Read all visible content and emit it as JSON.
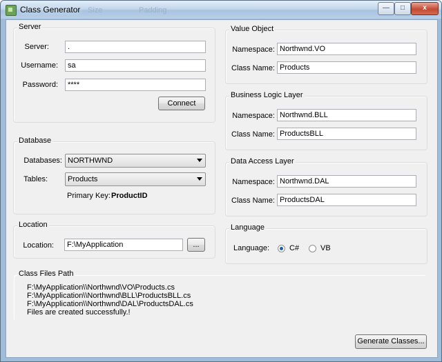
{
  "window": {
    "title": "Class Generator",
    "ghost_text_1": "Size",
    "ghost_text_2": "Padding",
    "minimize": "—",
    "maximize": "□",
    "close": "x"
  },
  "server": {
    "group": "Server",
    "server_label": "Server:",
    "server_value": ".",
    "username_label": "Username:",
    "username_value": "sa",
    "password_label": "Password:",
    "password_value": "****",
    "connect": "Connect"
  },
  "database": {
    "group": "Database",
    "databases_label": "Databases:",
    "databases_value": "NORTHWND",
    "tables_label": "Tables:",
    "tables_value": "Products",
    "pk_label": "Primary Key:",
    "pk_value": "ProductID"
  },
  "location": {
    "group": "Location",
    "label": "Location:",
    "value": "F:\\MyApplication",
    "browse": "..."
  },
  "value_object": {
    "group": "Value Object",
    "ns_label": "Namespace:",
    "ns_value": "Northwnd.VO",
    "cn_label": "Class Name:",
    "cn_value": "Products"
  },
  "bll": {
    "group": "Business Logic Layer",
    "ns_label": "Namespace:",
    "ns_value": "Northwnd.BLL",
    "cn_label": "Class Name:",
    "cn_value": "ProductsBLL"
  },
  "dal": {
    "group": "Data Access Layer",
    "ns_label": "Namespace:",
    "ns_value": "Northwnd.DAL",
    "cn_label": "Class Name:",
    "cn_value": "ProductsDAL"
  },
  "language": {
    "group": "Language",
    "label": "Language:",
    "opt1": "C#",
    "opt2": "VB",
    "selected": "C#"
  },
  "files": {
    "group": "Class Files Path",
    "lines": [
      "F:\\MyApplication\\\\Northwnd\\VO\\Products.cs",
      "F:\\MyApplication\\\\Northwnd\\BLL\\ProductsBLL.cs",
      "F:\\MyApplication\\\\Northwnd\\DAL\\ProductsDAL.cs",
      "Files are created successfully.!"
    ]
  },
  "generate": "Generate Classes..."
}
